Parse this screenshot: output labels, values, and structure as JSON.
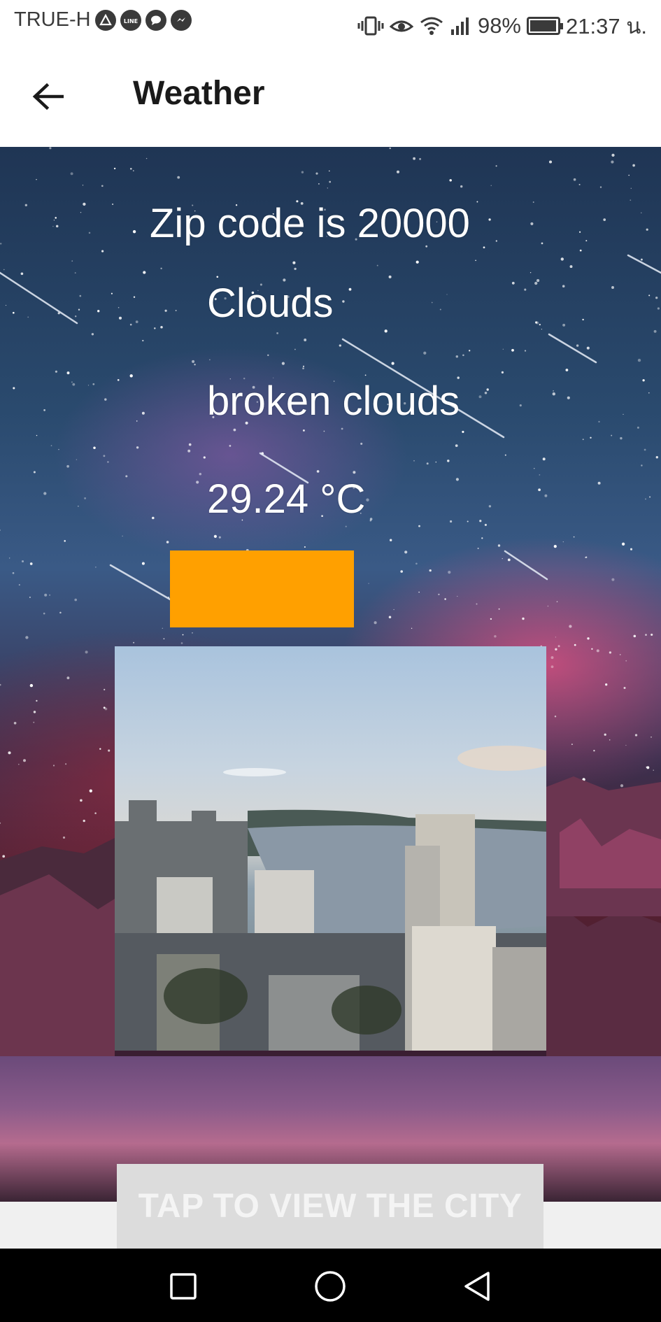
{
  "status_bar": {
    "carrier": "TRUE-H",
    "notification_icons": [
      "app-icon",
      "line-icon",
      "chat-icon",
      "messenger-icon"
    ],
    "system_icons": [
      "vibrate-icon",
      "eye-icon",
      "wifi-icon",
      "signal-icon"
    ],
    "battery_percent": "98%",
    "battery_level": 0.98,
    "time": "21:37 น."
  },
  "app_bar": {
    "back_icon": "arrow-left-icon",
    "title": "Weather"
  },
  "weather": {
    "zip_label": "Zip code is 20000",
    "main": "Clouds",
    "description": "broken clouds",
    "temperature": "29.24 °C"
  },
  "colors": {
    "accent_box": "#ffa000",
    "button_bg": "#dcdcdc",
    "button_text": "#f4f4f4"
  },
  "city_image": {
    "alt": "city-skyline-photo"
  },
  "tap_button": {
    "label": "TAP TO VIEW THE CITY"
  },
  "nav_bar": {
    "icons": [
      "square-recent-icon",
      "circle-home-icon",
      "triangle-back-icon"
    ]
  }
}
